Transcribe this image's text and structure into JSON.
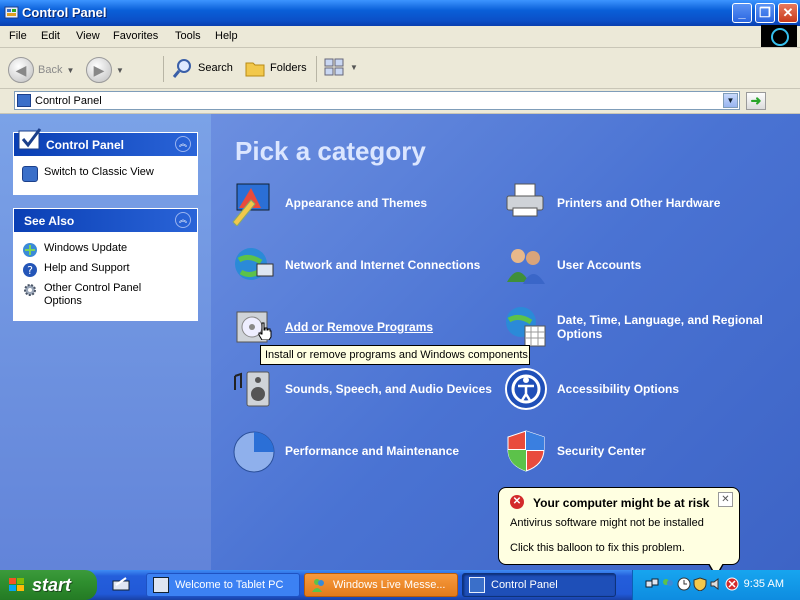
{
  "window": {
    "title": "Control Panel"
  },
  "menu": [
    "File",
    "Edit",
    "View",
    "Favorites",
    "Tools",
    "Help"
  ],
  "toolbar": {
    "back": "Back",
    "search": "Search",
    "folders": "Folders"
  },
  "address": {
    "value": "Control Panel"
  },
  "left_pane": {
    "control_panel": {
      "title": "Control Panel",
      "switch_link": "Switch to Classic View"
    },
    "see_also": {
      "title": "See Also",
      "items": [
        "Windows Update",
        "Help and Support",
        "Other Control Panel Options"
      ]
    }
  },
  "main": {
    "heading": "Pick a category",
    "categories": [
      "Appearance and Themes",
      "Printers and Other Hardware",
      "Network and Internet Connections",
      "User Accounts",
      "Add or Remove Programs",
      "Date, Time, Language, and Regional Options",
      "Sounds, Speech, and Audio Devices",
      "Accessibility Options",
      "Performance and Maintenance",
      "Security Center"
    ],
    "tooltip": "Install or remove programs and Windows components."
  },
  "balloon": {
    "title": "Your computer might be at risk",
    "line1": "Antivirus software might not be installed",
    "line2": "Click this balloon to fix this problem."
  },
  "taskbar": {
    "start": "start",
    "tasks": [
      "Welcome to Tablet PC",
      "Windows Live Messe...",
      "Control Panel"
    ],
    "clock": "9:35 AM"
  }
}
